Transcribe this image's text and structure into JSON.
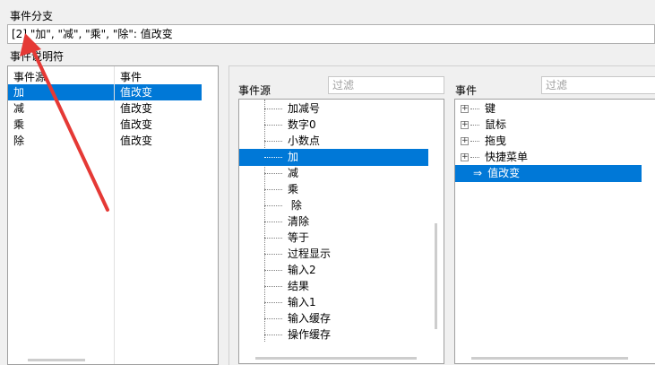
{
  "branch": {
    "title": "事件分支",
    "value": "[2] \"加\", \"减\", \"乘\", \"除\": 值改变"
  },
  "description": {
    "title": "事件说明符",
    "headers": [
      "事件源",
      "事件"
    ],
    "rows": [
      {
        "source": "加",
        "event": "值改变"
      },
      {
        "source": "减",
        "event": "值改变"
      },
      {
        "source": "乘",
        "event": "值改变"
      },
      {
        "source": "除",
        "event": "值改变"
      }
    ]
  },
  "sources": {
    "title": "事件源",
    "filter_placeholder": "过滤",
    "items": [
      "加减号",
      "数字0",
      "小数点",
      "加",
      "减",
      "乘",
      "除",
      "清除",
      "等于",
      "过程显示",
      "输入2",
      "结果",
      "输入1",
      "输入缓存",
      "操作缓存"
    ],
    "selected": "加"
  },
  "events": {
    "title": "事件",
    "filter_placeholder": "过滤",
    "items": [
      "键",
      "鼠标",
      "拖曳",
      "快捷菜单"
    ],
    "selected_item": "值改变",
    "selected_arrow": "⇒"
  },
  "annotation": {
    "color": "#e53935",
    "kind": "red-arrow"
  }
}
